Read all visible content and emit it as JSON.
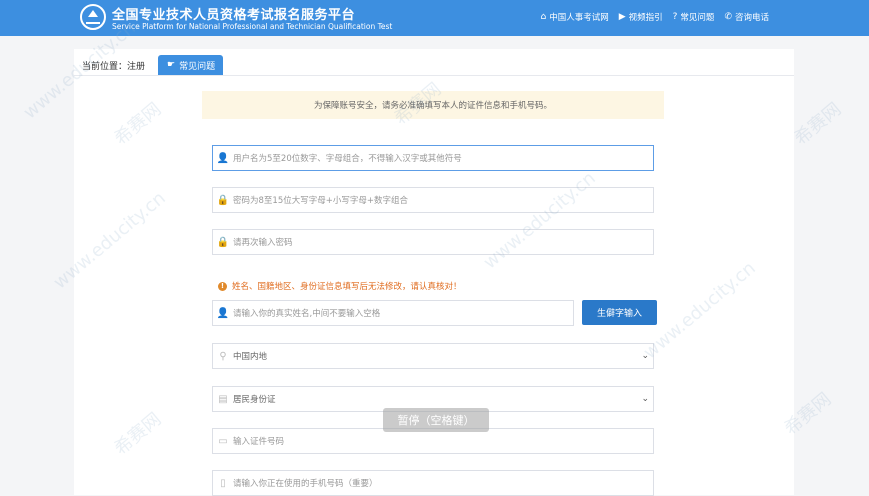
{
  "header": {
    "title": "全国专业技术人员资格考试报名服务平台",
    "subtitle": "Service Platform for National Professional and Technician Qualification Test",
    "nav": [
      {
        "label": "中国人事考试网",
        "icon": "home-icon"
      },
      {
        "label": "视频指引",
        "icon": "video-icon"
      },
      {
        "label": "常见问题",
        "icon": "question-icon"
      },
      {
        "label": "咨询电话",
        "icon": "phone-icon"
      }
    ]
  },
  "breadcrumb": {
    "text": "当前位置：注册"
  },
  "faq_tab": {
    "label": "常见问题"
  },
  "notice": {
    "text": "为保障账号安全，请务必准确填写本人的证件信息和手机号码。"
  },
  "form": {
    "username_placeholder": "用户名为5至20位数字、字母组合，不得输入汉字或其他符号",
    "password_placeholder": "密码为8至15位大写字母+小写字母+数字组合",
    "confirm_placeholder": "请再次输入密码",
    "warning": "姓名、国籍地区、身份证信息填写后无法修改，请认真核对！",
    "name_placeholder": "请输入你的真实姓名,中间不要输入空格",
    "rare_button": "生僻字输入",
    "region_value": "中国内地",
    "idtype_value": "居民身份证",
    "idnumber_placeholder": "输入证件号码",
    "phone_placeholder": "请输入你正在使用的手机号码（重要）"
  },
  "overlay": {
    "pause_label": "暂停（空格键）"
  },
  "watermark": {
    "cn": "希赛网",
    "url": "www.educity.cn"
  },
  "colors": {
    "header_blue": "#3d8fe0",
    "button_blue": "#2a79c9",
    "notice_bg": "#fdf6e3",
    "warning": "#e06c1f"
  }
}
